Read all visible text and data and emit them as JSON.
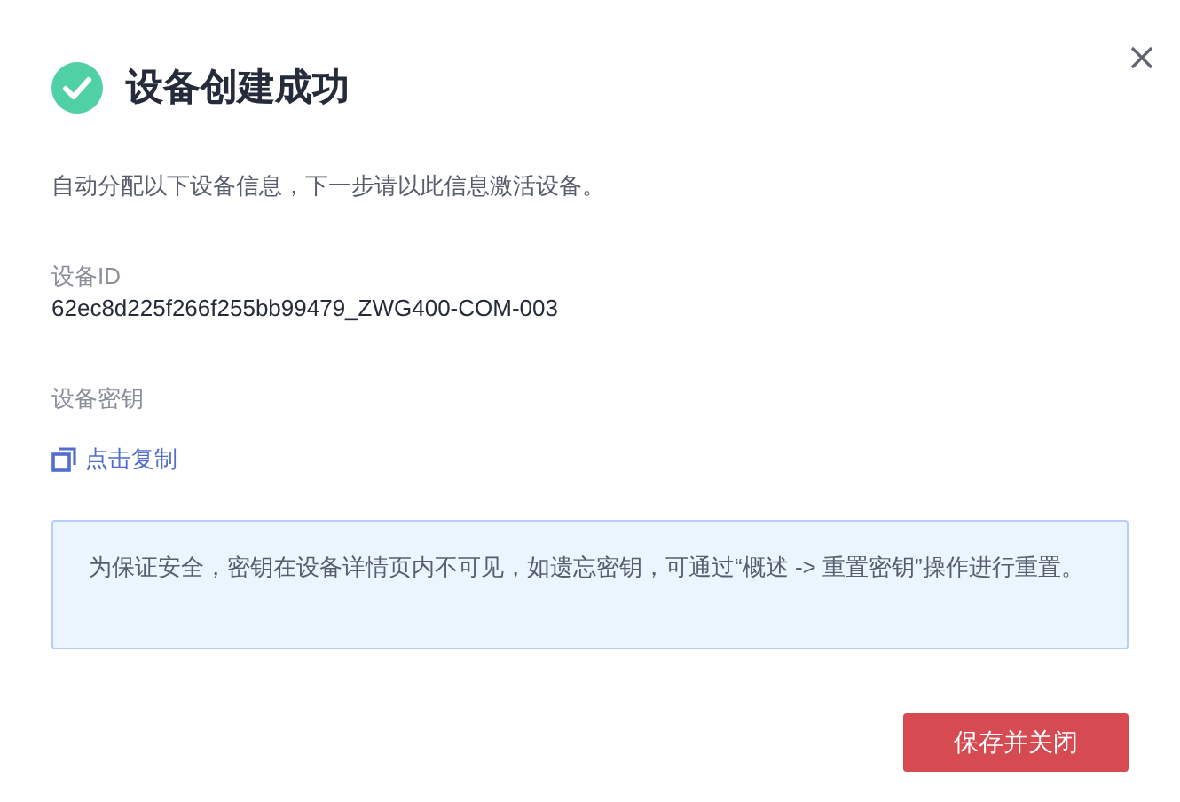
{
  "dialog": {
    "title": "设备创建成功",
    "description": "自动分配以下设备信息，下一步请以此信息激活设备。",
    "fields": [
      {
        "label": "设备ID",
        "value": "62ec8d225f266f255bb99479_ZWG400-COM-003"
      },
      {
        "label": "设备密钥",
        "link": "点击复制"
      }
    ],
    "notice": "为保证安全，密钥在设备详情页内不可见，如遗忘密钥，可通过“概述 -> 重置密钥”操作进行重置。",
    "buttons": [
      "保存并关闭"
    ]
  }
}
